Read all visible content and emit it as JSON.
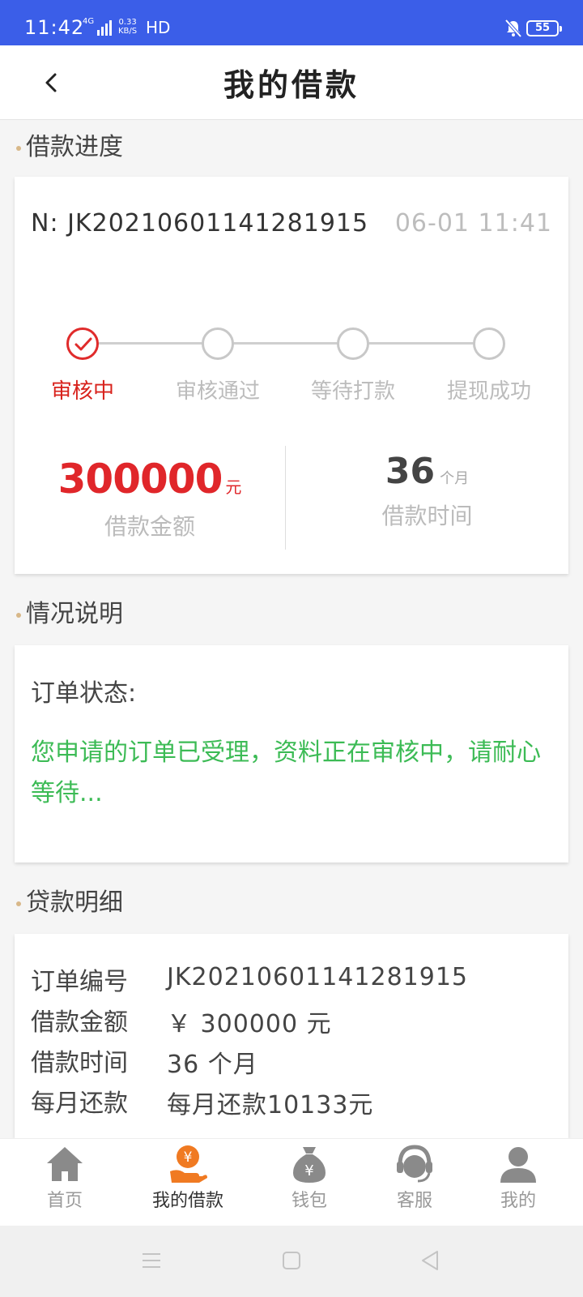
{
  "status_bar": {
    "time": "11:42",
    "network": "4G",
    "speed_top": "0.33",
    "speed_bottom": "KB/S",
    "hd": "HD",
    "battery": "55"
  },
  "header": {
    "title": "我的借款"
  },
  "progress_section": {
    "title": "借款进度",
    "order_no": "N: JK20210601141281915",
    "order_time": "06-01 11:41",
    "steps": [
      {
        "label": "审核中",
        "active": true
      },
      {
        "label": "审核通过",
        "active": false
      },
      {
        "label": "等待打款",
        "active": false
      },
      {
        "label": "提现成功",
        "active": false
      }
    ],
    "amount": {
      "value": "300000",
      "unit": "元",
      "label": "借款金额"
    },
    "term": {
      "value": "36",
      "unit": "个月",
      "label": "借款时间"
    }
  },
  "status_section": {
    "title": "情况说明",
    "label": "订单状态:",
    "text": "您申请的订单已受理，资料正在审核中，请耐心等待..."
  },
  "detail_section": {
    "title": "贷款明细",
    "rows": [
      {
        "key": "订单编号",
        "value": "JK20210601141281915"
      },
      {
        "key": "借款金额",
        "value": "￥ 300000 元"
      },
      {
        "key": "借款时间",
        "value": "36 个月"
      },
      {
        "key": "每月还款",
        "value": "每月还款10133元"
      }
    ]
  },
  "tabbar": {
    "items": [
      {
        "label": "首页",
        "icon": "home-icon"
      },
      {
        "label": "我的借款",
        "icon": "loan-hand-icon"
      },
      {
        "label": "钱包",
        "icon": "money-bag-icon"
      },
      {
        "label": "客服",
        "icon": "customer-service-icon"
      },
      {
        "label": "我的",
        "icon": "user-icon"
      }
    ],
    "active_index": 1,
    "active_color": "#f07a22"
  },
  "colors": {
    "status_bar": "#3b5ee8",
    "accent_red": "#e0262a",
    "status_green": "#3cbb55",
    "section_dot": "#d8b889"
  }
}
